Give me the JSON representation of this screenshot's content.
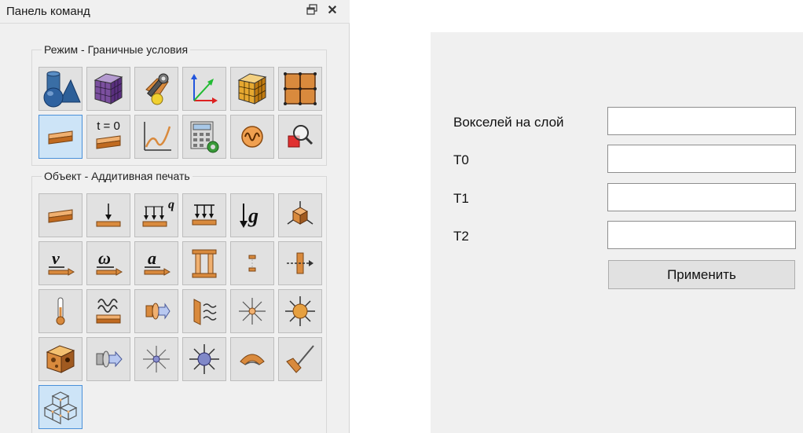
{
  "panel": {
    "title": "Панель команд",
    "float_icon": "restore-window-icon",
    "close_icon": "close-icon"
  },
  "groups": [
    {
      "title": "Режим - Граничные условия",
      "tools": [
        "geometry-shapes-icon",
        "voxel-mesh-icon",
        "wrench-settings-icon",
        "coordinate-axes-icon",
        "voxel-cube-icon",
        "grid-layout-icon",
        "plate-icon",
        "initial-temperature-icon",
        "graph-chart-icon",
        "calculator-icon",
        "oscillation-icon",
        "search-zoom-icon"
      ],
      "labels": {
        "t0_tool": "t = 0"
      }
    },
    {
      "title": "Объект - Аддитивная печать",
      "tools": [
        "plate-icon",
        "point-load-icon",
        "distributed-load-icon",
        "pressure-load-icon",
        "gravity-icon",
        "rotate-object-icon",
        "velocity-icon",
        "angular-velocity-icon",
        "acceleration-icon",
        "column-support-icon",
        "contact-gap-icon",
        "section-cut-icon",
        "thermometer-icon",
        "heat-flux-icon",
        "heat-source-icon",
        "convection-icon",
        "radiation-icon",
        "sun-radiation-icon",
        "cheese-block-icon",
        "heat-transfer-icon",
        "light-point-icon",
        "light-sphere-icon",
        "rubber-seal-icon",
        "brush-tool-icon",
        "lattice-structure-icon"
      ],
      "labels": {
        "q": "q",
        "g": "g",
        "v": "v",
        "omega": "ω",
        "a": "a"
      }
    }
  ],
  "form": {
    "fields": [
      {
        "label": "Вокселей на слой",
        "value": ""
      },
      {
        "label": "T0",
        "value": ""
      },
      {
        "label": "T1",
        "value": ""
      },
      {
        "label": "T2",
        "value": ""
      }
    ],
    "apply_label": "Применить"
  },
  "colors": {
    "accent": "#4a90d9",
    "plate": "#d98a3d",
    "panel_bg": "#f0f0f0"
  }
}
